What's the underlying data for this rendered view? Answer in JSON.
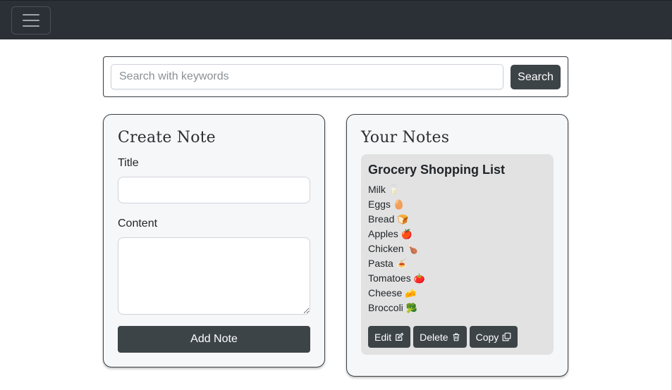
{
  "navbar": {
    "menu_icon": "hamburger-menu-icon"
  },
  "search": {
    "placeholder": "Search with keywords",
    "value": "",
    "button_label": "Search"
  },
  "create_note": {
    "heading": "Create Note",
    "title_label": "Title",
    "title_value": "",
    "content_label": "Content",
    "content_value": "",
    "add_button_label": "Add Note"
  },
  "notes": {
    "heading": "Your Notes",
    "items": [
      {
        "title": "Grocery Shopping List",
        "lines": [
          {
            "text": "Milk",
            "emoji": "🥛"
          },
          {
            "text": "Eggs",
            "emoji": "🥚"
          },
          {
            "text": "Bread",
            "emoji": "🍞"
          },
          {
            "text": "Apples",
            "emoji": "🍎"
          },
          {
            "text": "Chicken",
            "emoji": "🍗"
          },
          {
            "text": "Pasta",
            "emoji": "🍝"
          },
          {
            "text": "Tomatoes",
            "emoji": "🍅"
          },
          {
            "text": "Cheese",
            "emoji": "🧀"
          },
          {
            "text": "Broccoli",
            "emoji": "🥦"
          }
        ],
        "actions": {
          "edit": "Edit",
          "delete": "Delete",
          "copy": "Copy"
        },
        "icons": {
          "edit": "pencil-square-icon",
          "delete": "trash-icon",
          "copy": "copy-icon"
        }
      }
    ]
  },
  "colors": {
    "navbar": "#2b3036",
    "button": "#3d4448",
    "card_bg": "#f6f7f9",
    "note_bg": "#e2e2e2"
  }
}
